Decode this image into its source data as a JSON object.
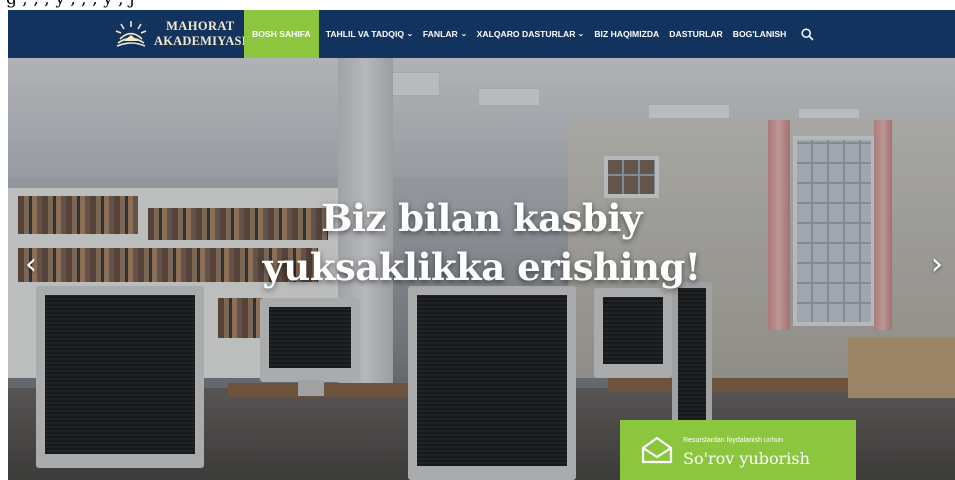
{
  "header": {
    "logo_line1": "MAHORAT",
    "logo_line2": "AKADEMIYASI",
    "nav": [
      {
        "label": "BOSH SAHIFA",
        "active": true
      },
      {
        "label": "TAHLIL VA TADQIQ",
        "dropdown": true
      },
      {
        "label": "FANLAR",
        "dropdown": true
      },
      {
        "label": "XALQARO DASTURLAR",
        "dropdown": true
      },
      {
        "label": "BIZ HAQIMIZDA"
      },
      {
        "label": "DASTURLAR"
      },
      {
        "label": "BOG'LANISH"
      }
    ],
    "search_icon": "search-icon"
  },
  "top_strip_text": "g ; , ; y , ; , y ; j",
  "hero": {
    "headline_line1": "Biz bilan kasbiy",
    "headline_line2": "yuksaklikka erishing!",
    "prev_arrow": "‹",
    "next_arrow": "›"
  },
  "cta": {
    "small_text": "Resurslardan foydalanish uchun",
    "big_text": "So'rov yuborish",
    "icon": "envelope-icon"
  },
  "colors": {
    "nav_bg": "#13335f",
    "accent_green": "#8cc63f",
    "logo_text": "#f4e9c8"
  }
}
